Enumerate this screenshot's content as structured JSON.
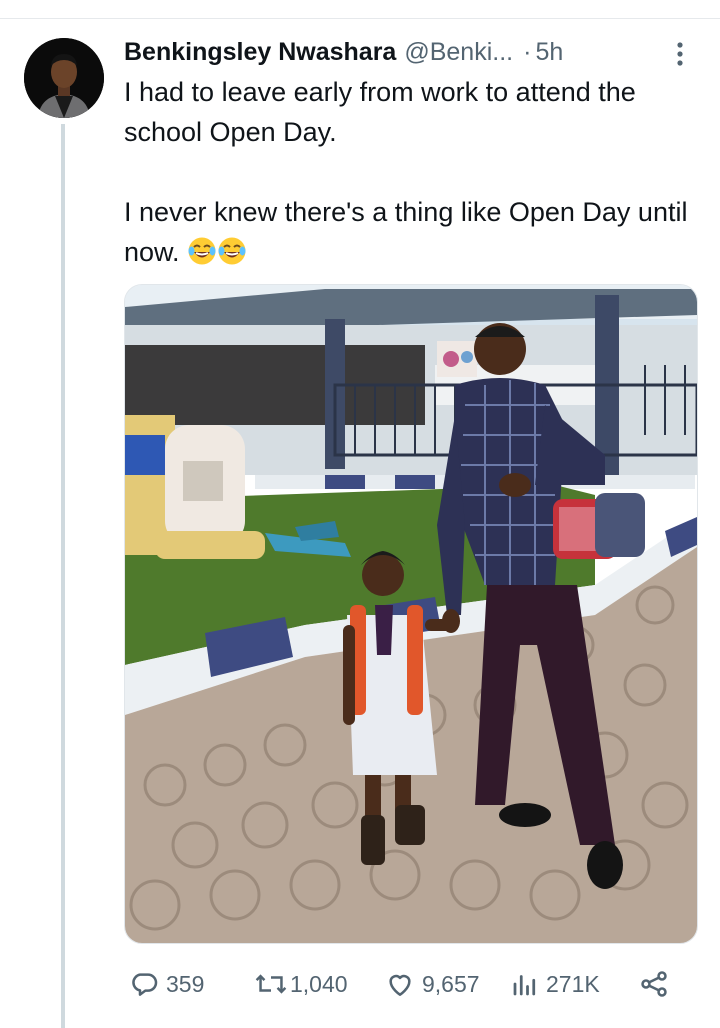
{
  "tweet": {
    "author_name": "Benkingsley Nwashara",
    "handle": "@Benki...",
    "separator": "·",
    "time": "5h",
    "text_line_1": "I had to leave early from work to attend the school Open Day.",
    "text_line_2": "I never knew there's a thing like Open Day until now.",
    "emojis": [
      "joy-emoji",
      "joy-emoji"
    ]
  },
  "stats": {
    "replies": "359",
    "retweets": "1,040",
    "likes": "9,657",
    "views": "271K"
  },
  "icons": {
    "avatar": "profile-avatar",
    "more": "more-vertical-icon",
    "reply": "reply-icon",
    "retweet": "retweet-icon",
    "like": "heart-icon",
    "views": "views-chart-icon",
    "share": "share-icon"
  },
  "colors": {
    "text_primary": "#0f1419",
    "text_secondary": "#536471",
    "thread_line": "#cfd9de"
  }
}
